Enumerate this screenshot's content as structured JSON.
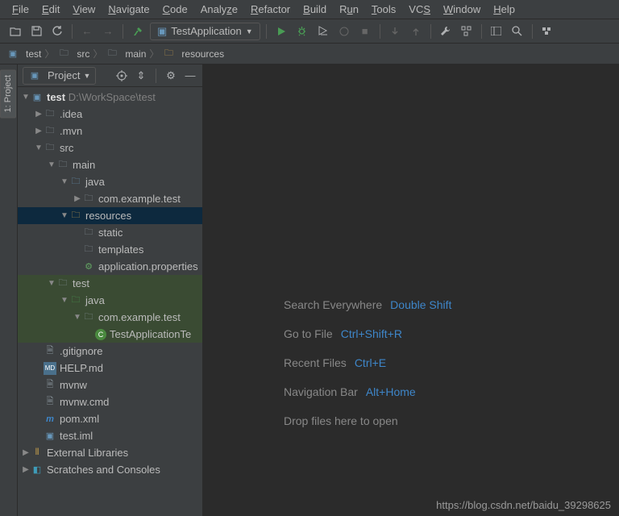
{
  "menu": [
    "File",
    "Edit",
    "View",
    "Navigate",
    "Code",
    "Analyze",
    "Refactor",
    "Build",
    "Run",
    "Tools",
    "VCS",
    "Window",
    "Help"
  ],
  "runConfig": {
    "label": "TestApplication"
  },
  "crumbs": [
    "test",
    "src",
    "main",
    "resources"
  ],
  "sidebar": {
    "panel": "Project",
    "tab": "1: Project",
    "root": {
      "name": "test",
      "path": "D:\\WorkSpace\\test"
    },
    "idea": ".idea",
    "mvn": ".mvn",
    "src": "src",
    "main": "main",
    "java_main": "java",
    "pkg_main": "com.example.test",
    "resources": "resources",
    "static": "static",
    "templates": "templates",
    "appprops": "application.properties",
    "test": "test",
    "java_test": "java",
    "pkg_test": "com.example.test",
    "testclass": "TestApplicationTe",
    "gitignore": ".gitignore",
    "help": "HELP.md",
    "mvnw": "mvnw",
    "mvnwcmd": "mvnw.cmd",
    "pom": "pom.xml",
    "testiml": "test.iml",
    "extlib": "External Libraries",
    "scratch": "Scratches and Consoles"
  },
  "hints": {
    "search": {
      "label": "Search Everywhere",
      "key": "Double Shift"
    },
    "goto": {
      "label": "Go to File",
      "key": "Ctrl+Shift+R"
    },
    "recent": {
      "label": "Recent Files",
      "key": "Ctrl+E"
    },
    "nav": {
      "label": "Navigation Bar",
      "key": "Alt+Home"
    },
    "drop": {
      "label": "Drop files here to open"
    }
  },
  "watermark": "https://blog.csdn.net/baidu_39298625"
}
